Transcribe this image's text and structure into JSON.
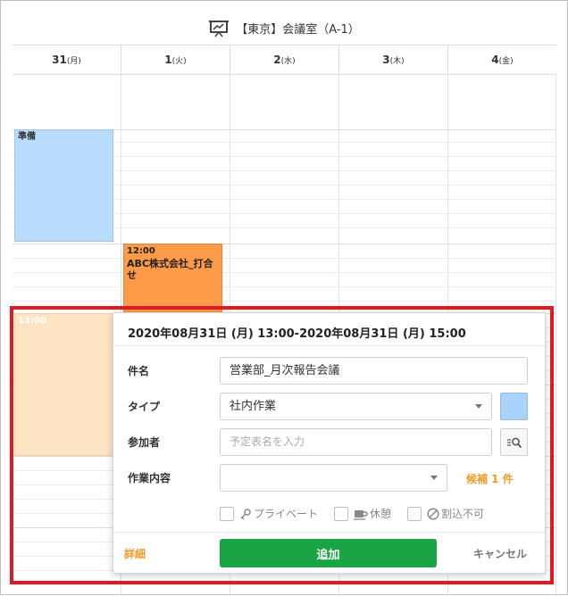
{
  "header": {
    "room": "【東京】会議室（A-1）",
    "room_icon": "presentation-board-icon"
  },
  "days": [
    {
      "num": "31",
      "weekday": "(月)"
    },
    {
      "num": "1",
      "weekday": "(火)"
    },
    {
      "num": "2",
      "weekday": "(水)"
    },
    {
      "num": "3",
      "weekday": "(木)"
    },
    {
      "num": "4",
      "weekday": "(金)"
    }
  ],
  "events": [
    {
      "time": "",
      "title": "準備",
      "color": "#b9dcfc"
    },
    {
      "time": "12:00",
      "title": "ABC株式会社_打合せ",
      "color": "#fd9b48"
    },
    {
      "time": "13:00",
      "title": "",
      "color": "#fde4c2"
    }
  ],
  "popup": {
    "datetime": "2020年08月31日 (月) 13:00-2020年08月31日 (月) 15:00",
    "subject_label": "件名",
    "subject_value": "営業部_月次報告会議",
    "type_label": "タイプ",
    "type_value": "社内作業",
    "type_color": "#a9d3f8",
    "participants_label": "参加者",
    "participants_placeholder": "予定表名を入力",
    "work_label": "作業内容",
    "work_value": "",
    "candidates": "候補 1 件",
    "private_label": "プライベート",
    "break_label": "休憩",
    "no_interrupt_label": "割込不可",
    "detail_label": "詳細",
    "add_label": "追加",
    "cancel_label": "キャンセル"
  },
  "colors": {
    "highlight": "#e01a22",
    "add_button": "#1aa343",
    "accent": "#f09a2a"
  }
}
